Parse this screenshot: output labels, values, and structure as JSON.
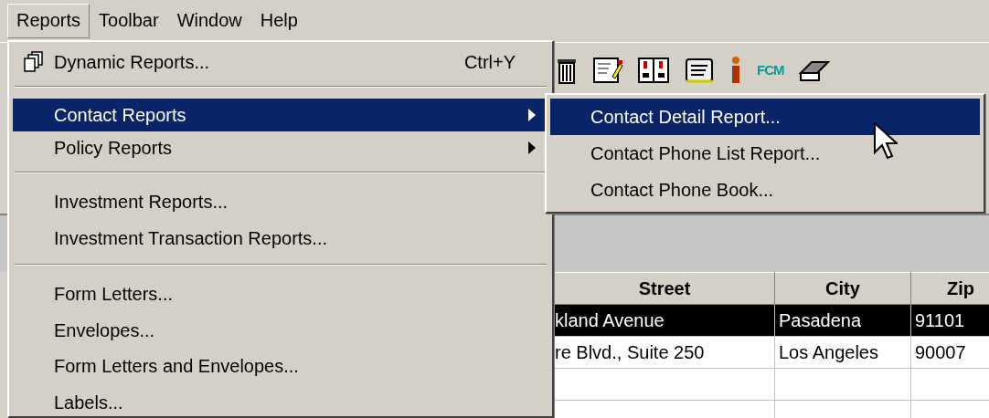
{
  "menu_bar": [
    {
      "label": "Reports",
      "selected": true
    },
    {
      "label": "Toolbar",
      "selected": false
    },
    {
      "label": "Window",
      "selected": false
    },
    {
      "label": "Help",
      "selected": false
    }
  ],
  "toolbar": [
    {
      "kind": "trash"
    },
    {
      "kind": "note"
    },
    {
      "kind": "cards"
    },
    {
      "kind": "scroll"
    },
    {
      "kind": "info"
    },
    {
      "kind": "text",
      "label": "FCM"
    },
    {
      "kind": "scanner"
    }
  ],
  "table": {
    "columns": [
      "Street",
      "City",
      "Zip"
    ],
    "rows": [
      {
        "cells": [
          "kland Avenue",
          "Pasadena",
          "91101"
        ],
        "selected": true
      },
      {
        "cells": [
          "re Blvd., Suite 250",
          "Los Angeles",
          "90007"
        ],
        "selected": false
      },
      {
        "cells": [],
        "selected": false
      },
      {
        "cells": [],
        "selected": false
      }
    ]
  },
  "reports_menu": [
    {
      "kind": "item",
      "label": "Dynamic Reports...",
      "shortcut": "Ctrl+Y",
      "icon": true,
      "selected": false
    },
    {
      "kind": "separator"
    },
    {
      "kind": "submenu",
      "label": "Contact Reports",
      "selected": true
    },
    {
      "kind": "submenu",
      "label": "Policy Reports",
      "selected": false
    },
    {
      "kind": "separator"
    },
    {
      "kind": "item",
      "label": "Investment Reports...",
      "selected": false
    },
    {
      "kind": "item",
      "label": "Investment Transaction Reports...",
      "selected": false
    },
    {
      "kind": "separator"
    },
    {
      "kind": "item",
      "label": "Form Letters...",
      "selected": false
    },
    {
      "kind": "item",
      "label": "Envelopes...",
      "selected": false
    },
    {
      "kind": "item",
      "label": "Form Letters and Envelopes...",
      "selected": false
    },
    {
      "kind": "item",
      "label": "Labels...",
      "selected": false
    }
  ],
  "contact_reports_submenu": [
    {
      "label": "Contact Detail Report...",
      "selected": true
    },
    {
      "label": "Contact Phone List Report...",
      "selected": false
    },
    {
      "label": "Contact Phone Book...",
      "selected": false
    }
  ]
}
